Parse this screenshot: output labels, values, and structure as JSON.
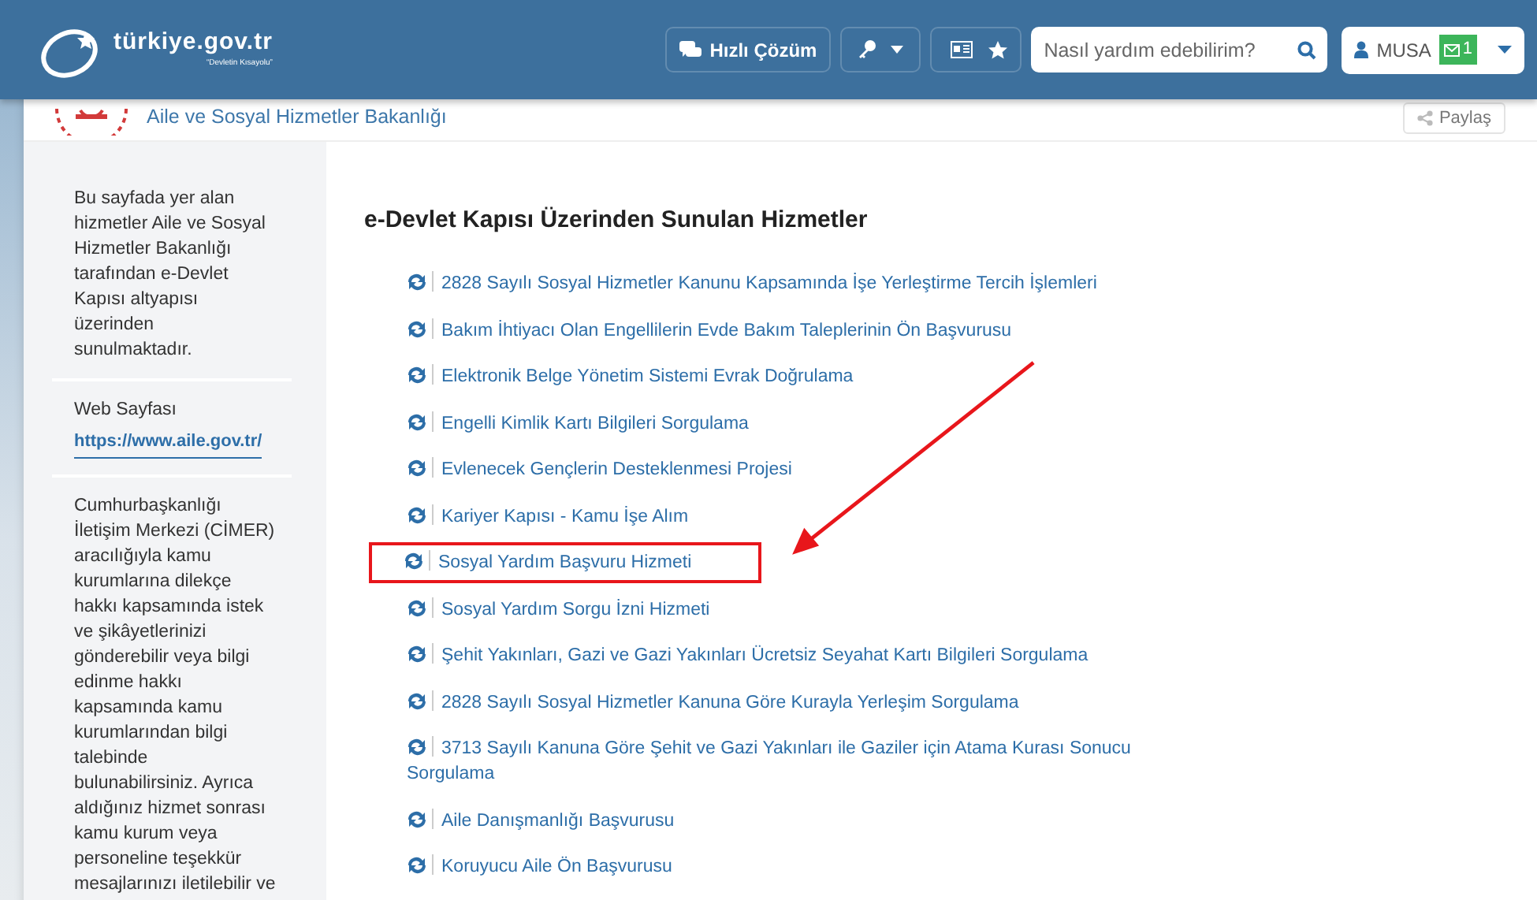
{
  "header": {
    "logo": "türkiye.gov.tr",
    "tagline": "“Devletin Kısayolu”",
    "quick_solution": "Hızlı Çözüm",
    "search": {
      "placeholder": "Nasıl yardım edebilirim?"
    },
    "user": {
      "name": "MUSA",
      "messages": "1"
    }
  },
  "ministry": {
    "title": "Aile ve Sosyal Hizmetler Bakanlığı",
    "share": "Paylaş"
  },
  "sidebar": {
    "intro": "Bu sayfada yer alan hizmetler Aile ve Sosyal Hizmetler Bakanlığı tarafından e-Devlet Kapısı altyapısı üzerinden sunulmaktadır.",
    "web_label": "Web Sayfası",
    "web_link": "https://www.aile.gov.tr/",
    "cimer": "Cumhurbaşkanlığı İletişim Merkezi (CİMER) aracılığıyla kamu kurumlarına dilekçe hakkı kapsamında istek ve şikâyetlerinizi gönderebilir veya bilgi edinme hakkı kapsamında kamu kurumlarından bilgi talebinde bulunabilirsiniz. Ayrıca aldığınız hizmet sonrası kamu kurum veya personeline teşekkür mesajlarınızı iletilebilir ve"
  },
  "content": {
    "heading": "e-Devlet Kapısı Üzerinden Sunulan Hizmetler",
    "services": [
      {
        "label": "2828 Sayılı Sosyal Hizmetler Kanunu Kapsamında İşe Yerleştirme Tercih İşlemleri",
        "highlighted": false
      },
      {
        "label": "Bakım İhtiyacı Olan Engellilerin Evde Bakım Taleplerinin Ön Başvurusu",
        "highlighted": false
      },
      {
        "label": "Elektronik Belge Yönetim Sistemi Evrak Doğrulama",
        "highlighted": false
      },
      {
        "label": "Engelli Kimlik Kartı Bilgileri Sorgulama",
        "highlighted": false
      },
      {
        "label": "Evlenecek Gençlerin Desteklenmesi Projesi",
        "highlighted": false
      },
      {
        "label": "Kariyer Kapısı - Kamu İşe Alım",
        "highlighted": false
      },
      {
        "label": "Sosyal Yardım Başvuru Hizmeti",
        "highlighted": true
      },
      {
        "label": "Sosyal Yardım Sorgu İzni Hizmeti",
        "highlighted": false
      },
      {
        "label": "Şehit Yakınları, Gazi ve Gazi Yakınları Ücretsiz Seyahat Kartı Bilgileri Sorgulama",
        "highlighted": false
      },
      {
        "label": "2828 Sayılı Sosyal Hizmetler Kanuna Göre Kurayla Yerleşim Sorgulama",
        "highlighted": false
      },
      {
        "label": "3713 Sayılı Kanuna Göre Şehit ve Gazi Yakınları ile Gaziler için Atama Kurası Sonucu Sorgulama",
        "highlighted": false
      },
      {
        "label": "Aile Danışmanlığı Başvurusu",
        "highlighted": false
      },
      {
        "label": "Koruyucu Aile Ön Başvurusu",
        "highlighted": false
      }
    ]
  }
}
